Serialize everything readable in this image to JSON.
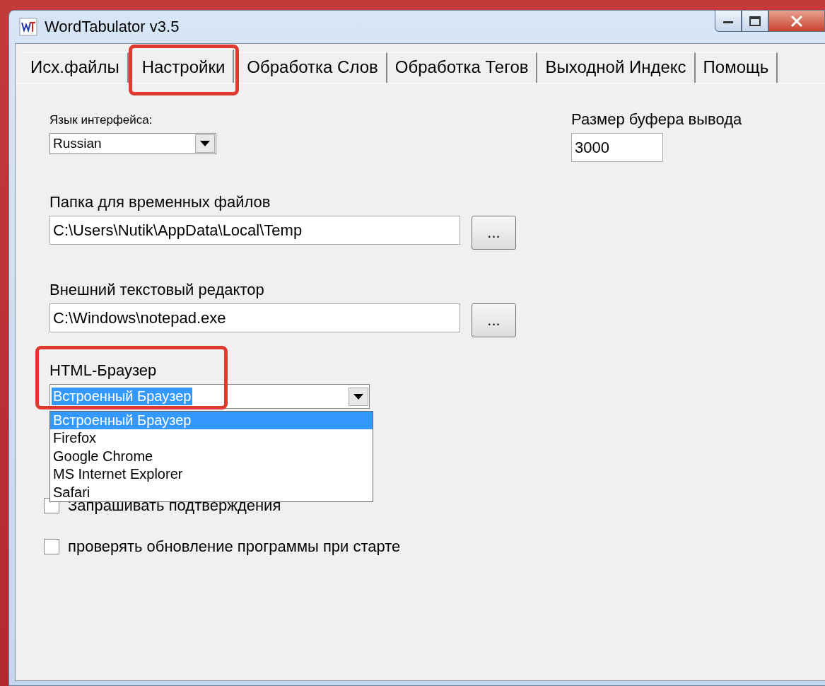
{
  "window": {
    "title": "WordTabulator v3.5"
  },
  "tabs": [
    {
      "label": "Исх.файлы",
      "selected": false,
      "highlighted": false
    },
    {
      "label": "Настройки",
      "selected": true,
      "highlighted": true
    },
    {
      "label": "Обработка Слов",
      "selected": false,
      "highlighted": false
    },
    {
      "label": "Обработка Тегов",
      "selected": false,
      "highlighted": false
    },
    {
      "label": "Выходной Индекс",
      "selected": false,
      "highlighted": false
    },
    {
      "label": "Помощь",
      "selected": false,
      "highlighted": false
    }
  ],
  "language": {
    "label": "Язык интерфейса:",
    "value": "Russian"
  },
  "buffer": {
    "label": "Размер буфера вывода",
    "value": "3000"
  },
  "temp_folder": {
    "label": "Папка для временных файлов",
    "value": "C:\\Users\\Nutik\\AppData\\Local\\Temp",
    "browse": "..."
  },
  "editor": {
    "label": "Внешний текстовый редактор",
    "value": "C:\\Windows\\notepad.exe",
    "browse": "..."
  },
  "browser": {
    "label": "HTML-Браузер",
    "value": "Встроенный Браузер",
    "highlighted": true,
    "expanded": true,
    "options": [
      {
        "label": "Встроенный Браузер",
        "selected": true
      },
      {
        "label": "Firefox",
        "selected": false
      },
      {
        "label": "Google Chrome",
        "selected": false
      },
      {
        "label": "MS Internet Explorer",
        "selected": false
      },
      {
        "label": "Safari",
        "selected": false
      }
    ]
  },
  "checkboxes": [
    {
      "label": "Запрашивать подтверждения",
      "checked": false
    },
    {
      "label": "проверять обновление программы при старте",
      "checked": false
    }
  ]
}
